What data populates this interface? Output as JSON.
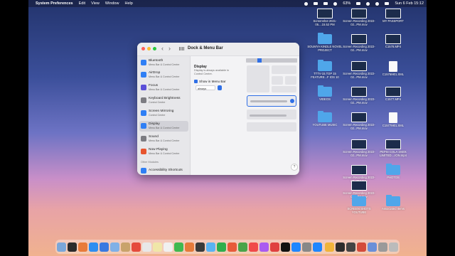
{
  "menubar": {
    "app": "System Preferences",
    "items": [
      "Edit",
      "View",
      "Window",
      "Help"
    ],
    "battery": "63%",
    "datetime": "Sun 6 Feb  15:12"
  },
  "window": {
    "title": "Dock & Menu Bar",
    "sidebar": [
      {
        "title": "Bluetooth",
        "subtitle": "Menu Bar & Control Centre",
        "color": "#2f7ff5"
      },
      {
        "title": "AirDrop",
        "subtitle": "Menu Bar & Control Centre",
        "color": "#2f7ff5"
      },
      {
        "title": "Focus",
        "subtitle": "Menu Bar & Control Centre",
        "color": "#5b4fd8"
      },
      {
        "title": "Keyboard Brightness",
        "subtitle": "Control Centre",
        "color": "#7c7c82"
      },
      {
        "title": "Screen Mirroring",
        "subtitle": "Control Centre",
        "color": "#2f7ff5"
      },
      {
        "title": "Display",
        "subtitle": "Menu Bar & Control Centre",
        "color": "#2f7ff5"
      },
      {
        "title": "Sound",
        "subtitle": "Menu Bar & Control Centre",
        "color": "#7c7c82"
      },
      {
        "title": "Now Playing",
        "subtitle": "Menu Bar & Control Centre",
        "color": "#e7552e"
      }
    ],
    "section": "Other Modules",
    "bottom_item": "Accessibility Shortcuts",
    "content": {
      "title": "Display",
      "desc": "Display is always available in Control Centre.",
      "checkbox_label": "Show in Menu Bar",
      "select_value": "always"
    },
    "help": "?"
  },
  "desktop": [
    {
      "label": "Screenshot 2021-05....15.52 PM",
      "kind": "thumb"
    },
    {
      "label": "Screen Recording 2022-02...PM.mov",
      "kind": "thumb"
    },
    {
      "label": "MY PASSPORT",
      "kind": "thumb"
    },
    {
      "label": "SOUMYA KINDLE NOVEL PROJECT",
      "kind": "folder"
    },
    {
      "label": "Screen Recording 2022-02...PM.mov",
      "kind": "thumb"
    },
    {
      "label": "C1578.MP4",
      "kind": "thumb"
    },
    {
      "label": "TTTV-15.TOP 15 FEATURE...F IOS 10",
      "kind": "folder"
    },
    {
      "label": "Screen Recording 2022-02...PM.mov",
      "kind": "thumb"
    },
    {
      "label": "C1576M01.XML",
      "kind": "doc"
    },
    {
      "label": "VIDEOS",
      "kind": "folder"
    },
    {
      "label": "Screen Recording 2022-02...PM.mov",
      "kind": "thumb"
    },
    {
      "label": "C1577.MP4",
      "kind": "thumb"
    },
    {
      "label": "YOUTUBE MUSIC",
      "kind": "folder"
    },
    {
      "label": "Screen Recording 2022-02...PM.mov",
      "kind": "thumb"
    },
    {
      "label": "C1577M01.XML",
      "kind": "doc"
    },
    {
      "label": "Screen Recording 2022-02...PM.mov",
      "kind": "thumb"
    },
    {
      "label": "PEPSI COLA 1940s LIMITED....ION.mp4",
      "kind": "thumb"
    },
    {
      "label": "Screen Recording 2022-02...PM.mov",
      "kind": "thumb"
    },
    {
      "label": "PHOTOS",
      "kind": "folder"
    },
    {
      "label": "Screen Recording 2022-02...PM.mov",
      "kind": "thumb"
    },
    {
      "label": "SCREEN SHOTS YOUTUBE",
      "kind": "folder"
    },
    {
      "label": "Associated Items",
      "kind": "folder"
    }
  ],
  "dock_colors": [
    "#7aa7d9",
    "#2b2b2b",
    "#e87b3a",
    "#2d8ef0",
    "#3a79e0",
    "#7fb0e6",
    "#c9a36b",
    "#e54b3c",
    "#e8e8e8",
    "#f0e6a8",
    "#f0f0f0",
    "#3fb950",
    "#e57a3a",
    "#3a3a3a",
    "#5ab3f2",
    "#2fae4d",
    "#e85a3a",
    "#4aa44a",
    "#f04a4a",
    "#aa5af0",
    "#e04040",
    "#111111",
    "#1f86ff",
    "#888888",
    "#1f86ff",
    "#f0b43a",
    "#2d2d2d",
    "#444444",
    "#d44b3b",
    "#6a8fd8",
    "#9a9a9a",
    "#bbbbbb"
  ]
}
